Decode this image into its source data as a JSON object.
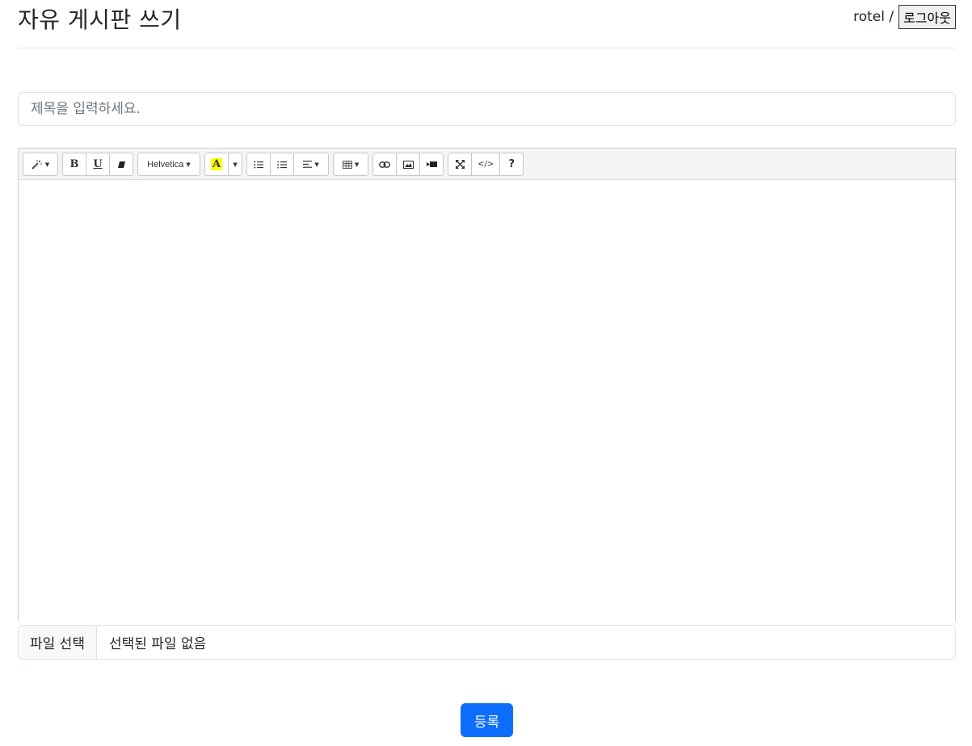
{
  "header": {
    "title": "자유 게시판 쓰기",
    "username": "rotel",
    "separator": "/",
    "logout_label": "로그아웃"
  },
  "form": {
    "title_placeholder": "제목을 입력하세요.",
    "title_value": "",
    "file_button_label": "파일 선택",
    "file_status": "선택된 파일 없음",
    "submit_label": "등록"
  },
  "toolbar": {
    "style_icon": "magic-wand-icon",
    "bold_label": "B",
    "underline_label": "U",
    "eraser_icon": "eraser-icon",
    "font_name": "Helvetica",
    "color_label": "A",
    "color_highlight": "#ffff00",
    "list_ul_icon": "unordered-list-icon",
    "list_ol_icon": "ordered-list-icon",
    "align_icon": "align-left-icon",
    "table_icon": "table-icon",
    "link_icon": "link-icon",
    "picture_icon": "picture-icon",
    "video_icon": "video-icon",
    "fullscreen_icon": "fullscreen-icon",
    "codeview_label": "</>",
    "help_label": "?"
  },
  "colors": {
    "primary": "#0d6efd",
    "toolbar_bg": "#f5f5f5"
  }
}
